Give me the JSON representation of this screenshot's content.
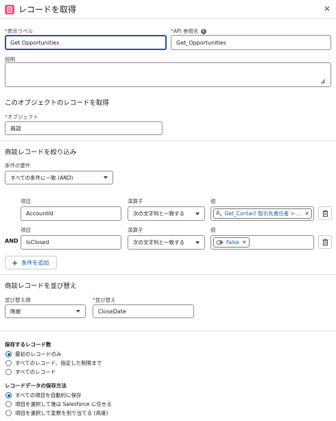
{
  "header": {
    "title": "レコードを取得",
    "close_icon": "close-icon"
  },
  "label_field": {
    "label": "表示ラベル",
    "value": "Get Opportunities"
  },
  "api_field": {
    "label": "API 参照名",
    "value": "Get_Opportunities"
  },
  "description_field": {
    "label": "説明",
    "value": ""
  },
  "object_section": {
    "title": "このオブジェクトのレコードを取得",
    "object_label": "オブジェクト",
    "object_value": "商談"
  },
  "filter_section": {
    "title": "商談レコードを絞り込み",
    "condition_label": "条件の要件",
    "condition_value": "すべての条件に一致 (AND)",
    "rows": [
      {
        "connector": "",
        "field_label": "項目",
        "field_value": "AccountId",
        "operator_label": "演算子",
        "operator_value": "次の文字列と一致する",
        "value_label": "値",
        "value_pill": "Get_Contact 取引先責任者 > ...",
        "value_icon": "text-resource-icon"
      },
      {
        "connector": "AND",
        "field_label": "項目",
        "field_value": "IsClosed",
        "operator_label": "演算子",
        "operator_value": "次の文字列と一致する",
        "value_label": "値",
        "value_pill": "False",
        "value_icon": "boolean-toggle-icon"
      }
    ],
    "add_condition": "条件を追加"
  },
  "sort_section": {
    "title": "商談レコードを並び替え",
    "order_label": "並び替え順",
    "order_value": "降順",
    "field_label": "並び替え",
    "field_value": "CloseDate"
  },
  "records_to_store": {
    "title": "保存するレコード数",
    "options": [
      "最初のレコードのみ",
      "すべてのレコード、指定した制限まで",
      "すべてのレコード"
    ],
    "selected": 0
  },
  "store_method": {
    "title": "レコードデータの保存方法",
    "options": [
      "すべての項目を自動的に保存",
      "項目を選択して後は Salesforce に任せる",
      "項目を選択して変数を割り当てる (高度)"
    ],
    "selected": 0
  },
  "colors": {
    "accent": "#0b5cab",
    "focus": "#1b5297",
    "icon_bg": "#e8507a",
    "required": "#c23934"
  }
}
